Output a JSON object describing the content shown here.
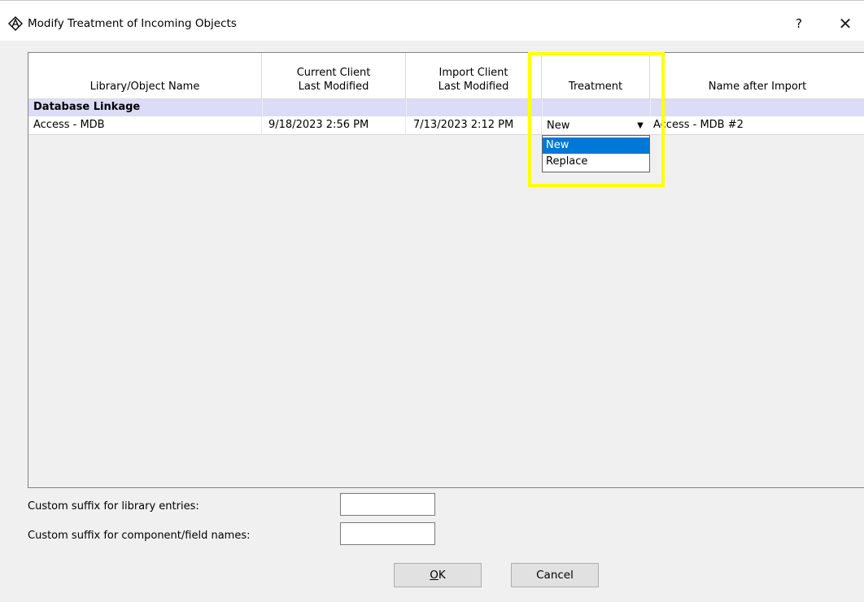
{
  "window": {
    "title": "Modify Treatment of Incoming Objects",
    "help_label": "?",
    "close_label": "✕"
  },
  "table": {
    "columns": [
      {
        "line1": "",
        "line2": "Library/Object Name"
      },
      {
        "line1": "Current Client",
        "line2": "Last Modified"
      },
      {
        "line1": "Import Client",
        "line2": "Last Modified"
      },
      {
        "line1": "",
        "line2": "Treatment"
      },
      {
        "line1": "",
        "line2": "Name after Import"
      }
    ],
    "group_label": "Database Linkage",
    "row": {
      "name": "Access - MDB",
      "current_modified": "9/18/2023  2:56 PM",
      "import_modified": "7/13/2023  2:12 PM",
      "treatment": "New",
      "name_after_import": "Access - MDB #2"
    },
    "treatment_options": [
      {
        "label": "New",
        "selected": true
      },
      {
        "label": "Replace",
        "selected": false
      }
    ]
  },
  "suffix": {
    "library_label": "Custom suffix for library entries:",
    "library_value": "",
    "component_label": "Custom suffix for component/field names:",
    "component_value": ""
  },
  "buttons": {
    "ok_mnemonic": "O",
    "ok_rest": "K",
    "cancel": "Cancel"
  },
  "colors": {
    "highlight": "#ffff00",
    "selection": "#0078d7",
    "group_row": "#dcdcf8"
  }
}
